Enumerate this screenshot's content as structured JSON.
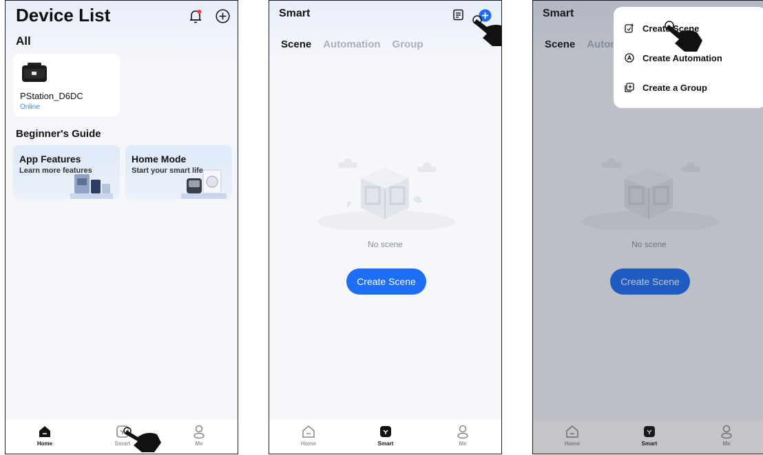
{
  "phone1": {
    "title": "Device List",
    "section_all": "All",
    "device": {
      "name": "PStation_D6DC",
      "status": "Online"
    },
    "guide_title": "Beginner's Guide",
    "guides": [
      {
        "title": "App Features",
        "subtitle": "Learn more features"
      },
      {
        "title": "Home Mode",
        "subtitle": "Start your smart life"
      }
    ]
  },
  "phone2": {
    "title": "Smart",
    "tabs": [
      "Scene",
      "Automation",
      "Group"
    ],
    "empty_text": "No scene",
    "create_button": "Create Scene"
  },
  "phone3": {
    "title": "Smart",
    "tabs": [
      "Scene",
      "Automation"
    ],
    "empty_text": "No scene",
    "create_button": "Create Scene",
    "menu": [
      "Create Scene",
      "Create Automation",
      "Create a Group"
    ]
  },
  "tabbar": {
    "home": "Home",
    "smart": "Smart",
    "me": "Me"
  },
  "colors": {
    "accent": "#1d6ef4",
    "online": "#2b88ff",
    "inactive_tab": "#a8afbd"
  }
}
